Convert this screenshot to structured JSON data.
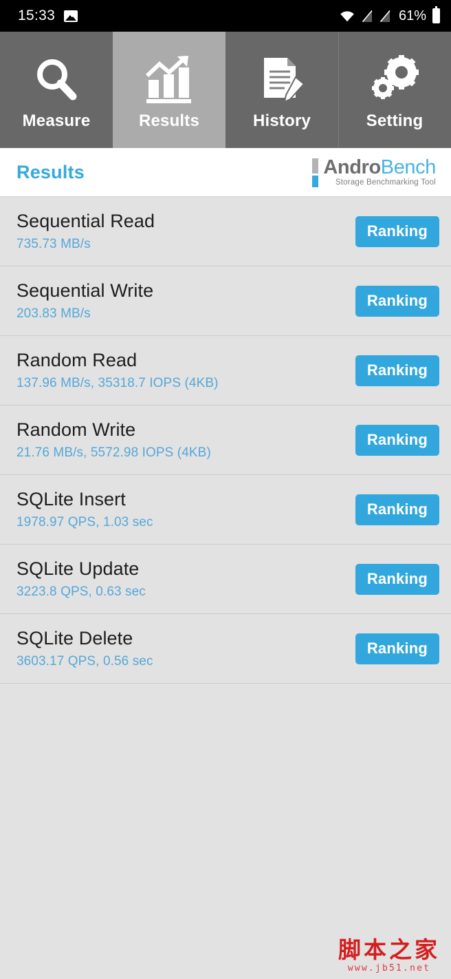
{
  "status_bar": {
    "time": "15:33",
    "battery_percent": "61%",
    "icons": [
      "photo-icon",
      "wifi-icon",
      "no-sim-icon",
      "no-sim-icon",
      "battery-icon"
    ]
  },
  "tabs": [
    {
      "label": "Measure",
      "icon": "magnifier-icon",
      "active": false
    },
    {
      "label": "Results",
      "icon": "bar-chart-icon",
      "active": true
    },
    {
      "label": "History",
      "icon": "document-pencil-icon",
      "active": false
    },
    {
      "label": "Setting",
      "icon": "gears-icon",
      "active": false
    }
  ],
  "header": {
    "title": "Results",
    "logo_primary": "Andro",
    "logo_secondary": "Bench",
    "logo_subtitle": "Storage Benchmarking Tool"
  },
  "results": [
    {
      "name": "Sequential Read",
      "value": "735.73 MB/s",
      "button": "Ranking"
    },
    {
      "name": "Sequential Write",
      "value": "203.83 MB/s",
      "button": "Ranking"
    },
    {
      "name": "Random Read",
      "value": "137.96 MB/s, 35318.7 IOPS (4KB)",
      "button": "Ranking"
    },
    {
      "name": "Random Write",
      "value": "21.76 MB/s, 5572.98 IOPS (4KB)",
      "button": "Ranking"
    },
    {
      "name": "SQLite Insert",
      "value": "1978.97 QPS, 1.03 sec",
      "button": "Ranking"
    },
    {
      "name": "SQLite Update",
      "value": "3223.8 QPS, 0.63 sec",
      "button": "Ranking"
    },
    {
      "name": "SQLite Delete",
      "value": "3603.17 QPS, 0.56 sec",
      "button": "Ranking"
    }
  ],
  "watermark": {
    "text": "脚本之家",
    "url": "www.jb51.net"
  },
  "colors": {
    "accent_blue": "#32a7de",
    "value_blue": "#55a7d8",
    "tab_inactive": "#686868",
    "tab_active": "#ababab",
    "page_background": "#e2e2e2",
    "status_bar": "#000000",
    "watermark_red": "#d51e1e"
  }
}
